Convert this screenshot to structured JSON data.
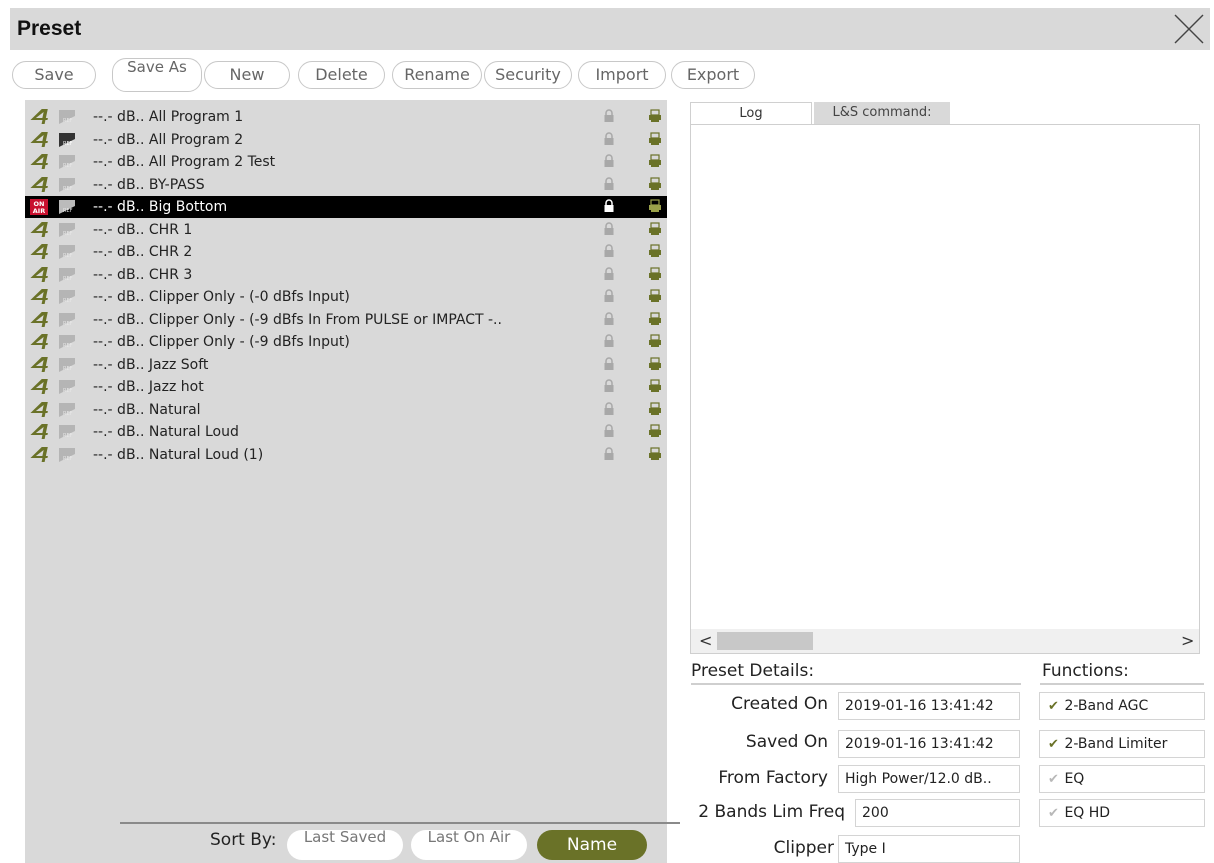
{
  "window": {
    "title": "Preset"
  },
  "toolbar": {
    "save": "Save",
    "save_as": "Save As",
    "new": "New",
    "delete": "Delete",
    "rename": "Rename",
    "security": "Security",
    "import": "Import",
    "export": "Export"
  },
  "presets": [
    {
      "level": "--.- dB..",
      "name": "All Program 1",
      "state": "normal",
      "ref": false
    },
    {
      "level": "--.- dB..",
      "name": "All Program 2",
      "state": "normal",
      "ref": true
    },
    {
      "level": "--.- dB..",
      "name": "All Program 2 Test",
      "state": "normal",
      "ref": false
    },
    {
      "level": "--.- dB..",
      "name": "BY-PASS",
      "state": "normal",
      "ref": false
    },
    {
      "level": "--.- dB..",
      "name": "Big Bottom",
      "state": "on-air",
      "ref": false
    },
    {
      "level": "--.- dB..",
      "name": "CHR 1",
      "state": "normal",
      "ref": false
    },
    {
      "level": "--.- dB..",
      "name": "CHR 2",
      "state": "normal",
      "ref": false
    },
    {
      "level": "--.- dB..",
      "name": "CHR 3",
      "state": "normal",
      "ref": false
    },
    {
      "level": "--.- dB..",
      "name": "Clipper Only - (-0 dBfs Input)",
      "state": "normal",
      "ref": false
    },
    {
      "level": "--.- dB..",
      "name": "Clipper Only - (-9 dBfs In From PULSE or IMPACT -..",
      "state": "normal",
      "ref": false
    },
    {
      "level": "--.- dB..",
      "name": "Clipper Only - (-9 dBfs Input)",
      "state": "normal",
      "ref": false
    },
    {
      "level": "--.- dB..",
      "name": "Jazz Soft",
      "state": "normal",
      "ref": false
    },
    {
      "level": "--.- dB..",
      "name": "Jazz hot",
      "state": "normal",
      "ref": false
    },
    {
      "level": "--.- dB..",
      "name": "Natural",
      "state": "normal",
      "ref": false
    },
    {
      "level": "--.- dB..",
      "name": "Natural Loud",
      "state": "normal",
      "ref": false
    },
    {
      "level": "--.- dB..",
      "name": "Natural Loud (1)",
      "state": "normal",
      "ref": false
    }
  ],
  "icons": {
    "preset": "4-icon",
    "ref": "ref-flag-icon",
    "on_air": "on-air-icon",
    "lock": "lock-icon",
    "print": "printer-icon",
    "on_air_text_1": "ON",
    "on_air_text_2": "AIR",
    "ref_text": "REF"
  },
  "sort": {
    "label": "Sort By:",
    "last_saved": "Last Saved",
    "last_on_air": "Last On Air",
    "name": "Name",
    "active": "name"
  },
  "tabs": {
    "log": "Log",
    "ls": "L&S command:"
  },
  "log": {
    "scroll_left": "<",
    "scroll_right": ">"
  },
  "details": {
    "header": "Preset Details:",
    "created_on_label": "Created On",
    "created_on": "2019-01-16 13:41:42",
    "saved_on_label": "Saved On",
    "saved_on": "2019-01-16 13:41:42",
    "from_factory_label": "From Factory",
    "from_factory": "High Power/12.0 dB..",
    "lim_freq_label": "2 Bands Lim Freq",
    "lim_freq": "200",
    "clipper_label": "Clipper",
    "clipper": "Type I"
  },
  "functions": {
    "header": "Functions:",
    "items": [
      {
        "label": "2-Band AGC",
        "enabled": true
      },
      {
        "label": "2-Band Limiter",
        "enabled": true
      },
      {
        "label": "EQ",
        "enabled": false
      },
      {
        "label": "EQ HD",
        "enabled": false
      }
    ]
  },
  "colors": {
    "accent": "#6a7228",
    "panel": "#d9d9d9",
    "on_air": "#c8102e"
  }
}
